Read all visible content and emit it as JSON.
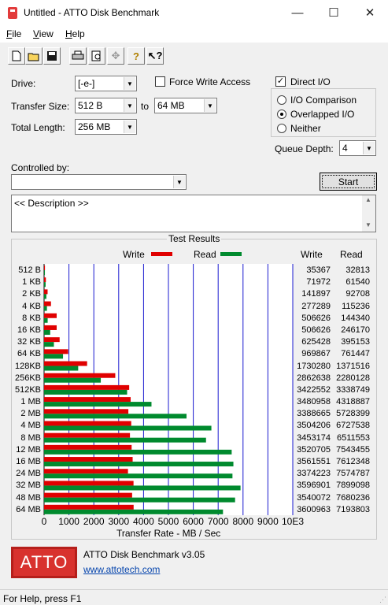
{
  "window": {
    "title": "Untitled - ATTO Disk Benchmark",
    "minimize_glyph": "—",
    "maximize_glyph": "☐",
    "close_glyph": "✕"
  },
  "menu": [
    {
      "label": "File",
      "accel": "F",
      "rest": "ile"
    },
    {
      "label": "View",
      "accel": "V",
      "rest": "iew"
    },
    {
      "label": "Help",
      "accel": "H",
      "rest": "elp"
    }
  ],
  "toolbar": [
    "new-icon",
    "open-icon",
    "save-icon",
    "print-icon",
    "print-preview-icon",
    "move-icon",
    "help-icon",
    "context-help-icon"
  ],
  "settings": {
    "drive_label": "Drive:",
    "drive_value": "[-e-]",
    "transfer_size_label": "Transfer Size:",
    "transfer_from": "512 B",
    "to_label": "to",
    "transfer_to": "64 MB",
    "total_length_label": "Total Length:",
    "total_length_value": "256 MB",
    "force_write_access_label": "Force Write Access",
    "force_write_access_checked": false,
    "direct_io_label": "Direct I/O",
    "direct_io_checked": true,
    "io_mode_options": [
      "I/O Comparison",
      "Overlapped I/O",
      "Neither"
    ],
    "io_mode_selected": "Overlapped I/O",
    "queue_depth_label": "Queue Depth:",
    "queue_depth_value": "4",
    "controlled_by_label": "Controlled by:",
    "controlled_by_value": "",
    "start_label": "Start"
  },
  "description": "<< Description >>",
  "results": {
    "title": "Test Results",
    "legend_write": "Write",
    "legend_read": "Read",
    "col_write": "Write",
    "col_read": "Read",
    "x_axis_label": "Transfer Rate - MB / Sec",
    "colors": {
      "write": "#e00000",
      "read": "#008a2e",
      "grid": "#1a1ad0"
    }
  },
  "chart_data": {
    "type": "bar",
    "orientation": "horizontal",
    "categories": [
      "512 B",
      "1 KB",
      "2 KB",
      "4 KB",
      "8 KB",
      "16 KB",
      "32 KB",
      "64 KB",
      "128KB",
      "256KB",
      "512KB",
      "1 MB",
      "2 MB",
      "4 MB",
      "8 MB",
      "12 MB",
      "16 MB",
      "24 MB",
      "32 MB",
      "48 MB",
      "64 MB"
    ],
    "series": [
      {
        "name": "Write",
        "values": [
          35367,
          71972,
          141897,
          277289,
          506626,
          506626,
          625428,
          969867,
          1730280,
          2862638,
          3422552,
          3480958,
          3388665,
          3504206,
          3453174,
          3520705,
          3561551,
          3374223,
          3596901,
          3540072,
          3600963
        ]
      },
      {
        "name": "Read",
        "values": [
          32813,
          61540,
          92708,
          115236,
          144340,
          246170,
          395153,
          761447,
          1371516,
          2280128,
          3338749,
          4318887,
          5728399,
          6727538,
          6511553,
          7543455,
          7612348,
          7574787,
          7899098,
          7680236,
          7193803
        ]
      }
    ],
    "x_ticks": [
      "0",
      "1000",
      "2000",
      "3000",
      "4000",
      "5000",
      "6000",
      "7000",
      "8000",
      "9000",
      "10E3"
    ],
    "xlabel": "Transfer Rate - MB / Sec",
    "xlim": [
      0,
      10000000
    ],
    "grid": true,
    "legend": "top"
  },
  "footer": {
    "logo_text": "ATTO",
    "version": "ATTO Disk Benchmark v3.05",
    "url": "www.attotech.com"
  },
  "status": "For Help, press F1"
}
